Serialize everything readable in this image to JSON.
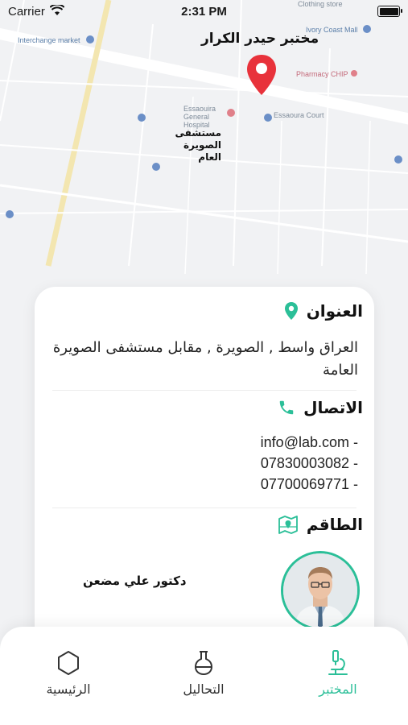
{
  "status_bar": {
    "carrier": "Carrier",
    "time": "2:31 PM"
  },
  "map": {
    "lab_title": "مختبر حيدر الكرار",
    "hospital_label": "مستشفى الصويرة العام",
    "labels": {
      "interchange": "Interchange market",
      "ivory": "Ivory Coast Mall",
      "pharmacy": "Pharmacy CHIP",
      "general_hospital": "Essaouira General Hospital",
      "court": "Essaoura Court",
      "clothing": "Clothing store"
    }
  },
  "card": {
    "address": {
      "heading": "العنوان",
      "text": "العراق واسط , الصويرة , مقابل مستشفى الصويرة العامة"
    },
    "contact": {
      "heading": "الاتصال",
      "items": [
        "info@lab.com -",
        "07830003082 -",
        "07700069771 -"
      ]
    },
    "staff": {
      "heading": "الطاقم",
      "members": [
        {
          "name": "دكتور علي مضعن"
        }
      ]
    }
  },
  "tabbar": {
    "lab": "المختبر",
    "tests": "التحاليل",
    "home": "الرئيسية",
    "accent": "#2bbf98"
  }
}
